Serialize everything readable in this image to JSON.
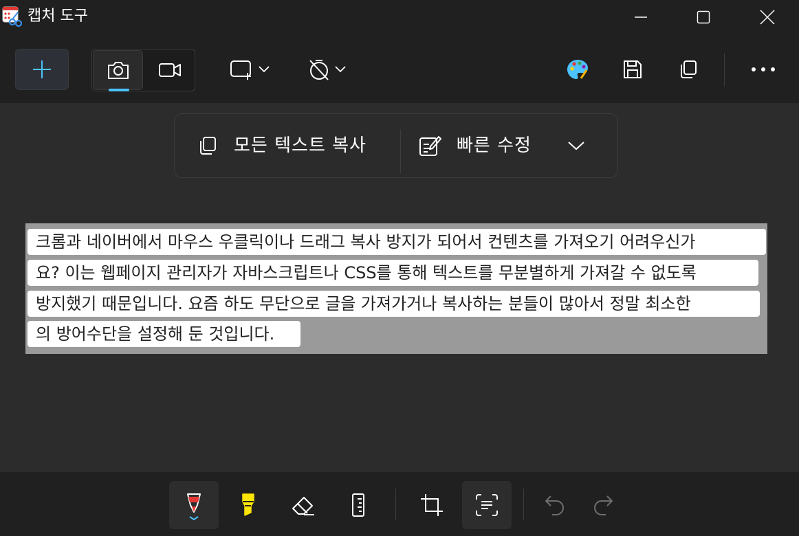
{
  "window": {
    "title": "캡처 도구",
    "icon": "snipping-tool-icon"
  },
  "toolbar": {
    "new_icon": "plus-icon",
    "photo_mode_icon": "camera-icon",
    "video_mode_icon": "video-icon",
    "snip_shape_icon": "rectangle-snip-icon",
    "delay_icon": "timer-off-icon",
    "paint_icon": "palette-icon",
    "save_icon": "save-icon",
    "copy_icon": "copy-icon",
    "more_icon": "more-icon"
  },
  "text_actions": {
    "copy_all_label": "모든 텍스트 복사",
    "quick_redact_label": "빠른 수정"
  },
  "captured_text": {
    "lines": [
      "크롬과 네이버에서 마우스 우클릭이나 드래그 복사 방지가 되어서 컨텐츠를 가져오기 어려우신가",
      "요? 이는 웹페이지 관리자가 자바스크립트나 CSS를 통해 텍스트를 무분별하게 가져갈 수 없도록",
      "방지했기 때문입니다. 요즘 하도 무단으로 글을 가져가거나 복사하는 분들이 많아서 정말 최소한",
      "의 방어수단을 설정해 둔 것입니다."
    ]
  },
  "bottom_tools": {
    "pen": "pen-icon",
    "highlighter": "highlighter-icon",
    "eraser": "eraser-icon",
    "ruler": "ruler-icon",
    "crop": "crop-icon",
    "text_actions": "text-actions-icon",
    "undo": "undo-icon",
    "redo": "redo-icon"
  },
  "colors": {
    "accent": "#4cc2ff",
    "pen": "#e53935",
    "highlighter": "#ffe600"
  }
}
